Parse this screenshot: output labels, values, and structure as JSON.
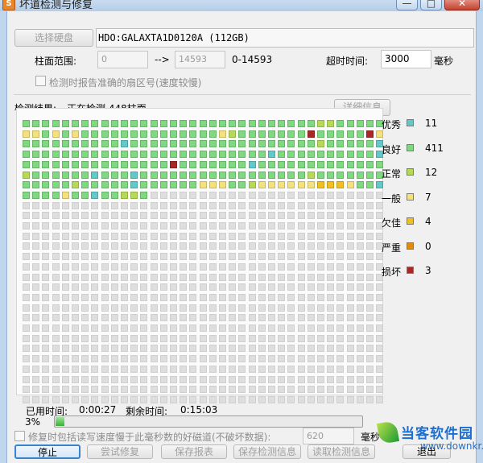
{
  "window": {
    "title": "坏道检测与修复",
    "app_icon": "S",
    "minimize": "—",
    "maximize": "□",
    "close": "✕"
  },
  "disk": {
    "select_label": "选择硬盘",
    "name": "HDO:GALAXTA1D0120A (112GB)"
  },
  "range": {
    "label": "柱面范围:",
    "start": "0",
    "arrow": "-->",
    "end": "14593",
    "span": "0-14593"
  },
  "timeout": {
    "label": "超时时间:",
    "value": "3000",
    "unit": "毫秒"
  },
  "report_option": {
    "label": "检测时报告准确的扇区号(速度较慢)",
    "checked": false
  },
  "result": {
    "label": "检测结果:",
    "status": "正在检测 448柱面",
    "detail_label": "详细信息"
  },
  "grid": {
    "cols": 37,
    "rows": 28,
    "scanned": 272,
    "colors": {
      "good": "#7fd981",
      "excellent": "#62c8c8",
      "normal": "#b6d958",
      "fair": "#f4e07c",
      "poor": "#f0c020",
      "bad_serious": "#e08a10",
      "damaged": "#a82828",
      "empty": "#dedede"
    },
    "overrides": [
      [
        37,
        "fair"
      ],
      [
        38,
        "fair"
      ],
      [
        40,
        "fair"
      ],
      [
        42,
        "fair"
      ],
      [
        66,
        "damaged"
      ],
      [
        72,
        "damaged"
      ],
      [
        73,
        "fair"
      ],
      [
        84,
        "excellent"
      ],
      [
        104,
        "normal"
      ],
      [
        110,
        "excellent"
      ],
      [
        136,
        "excellent"
      ],
      [
        147,
        "excellent"
      ],
      [
        163,
        "damaged"
      ],
      [
        171,
        "excellent"
      ],
      [
        185,
        "normal"
      ],
      [
        192,
        "excellent"
      ],
      [
        196,
        "excellent"
      ],
      [
        214,
        "normal"
      ],
      [
        227,
        "normal"
      ],
      [
        233,
        "excellent"
      ],
      [
        240,
        "fair"
      ],
      [
        241,
        "fair"
      ],
      [
        242,
        "fair"
      ],
      [
        245,
        "normal"
      ],
      [
        246,
        "fair"
      ],
      [
        247,
        "fair"
      ],
      [
        248,
        "fair"
      ],
      [
        249,
        "fair"
      ],
      [
        250,
        "fair"
      ],
      [
        251,
        "fair"
      ],
      [
        252,
        "poor"
      ],
      [
        253,
        "poor"
      ],
      [
        254,
        "poor"
      ],
      [
        255,
        "fair"
      ],
      [
        258,
        "excellent"
      ],
      [
        263,
        "fair"
      ],
      [
        266,
        "excellent"
      ],
      [
        269,
        "normal"
      ],
      [
        270,
        "normal"
      ],
      [
        30,
        "normal"
      ],
      [
        31,
        "normal"
      ],
      [
        57,
        "fair"
      ],
      [
        58,
        "normal"
      ]
    ]
  },
  "legend": [
    {
      "name": "优秀",
      "color": "#62c8c8",
      "count": "11"
    },
    {
      "name": "良好",
      "color": "#7fd981",
      "count": "411"
    },
    {
      "name": "正常",
      "color": "#b6d958",
      "count": "12"
    },
    {
      "name": "一般",
      "color": "#f4e07c",
      "count": "7"
    },
    {
      "name": "欠佳",
      "color": "#f0c020",
      "count": "4"
    },
    {
      "name": "严重",
      "color": "#e08a10",
      "count": "0"
    },
    {
      "name": "损坏",
      "color": "#a82828",
      "count": "3"
    }
  ],
  "time": {
    "elapsed_label": "已用时间:",
    "elapsed": "0:00:27",
    "remaining_label": "剩余时间:",
    "remaining": "0:15:03"
  },
  "progress": {
    "percent_label": "3%",
    "value": 0.03
  },
  "repair_option": {
    "label": "修复时包括读写速度慢于此毫秒数的好磁道(不破坏数据):",
    "value": "620",
    "unit": "毫秒",
    "checked": false
  },
  "buttons": {
    "stop": "停止",
    "try_repair": "尝试修复",
    "save_report": "保存报表",
    "save_info": "保存检测信息",
    "load_info": "读取检测信息",
    "exit": "退出"
  },
  "watermark": {
    "text": "当客软件园",
    "domain": "www.downkr.com"
  }
}
